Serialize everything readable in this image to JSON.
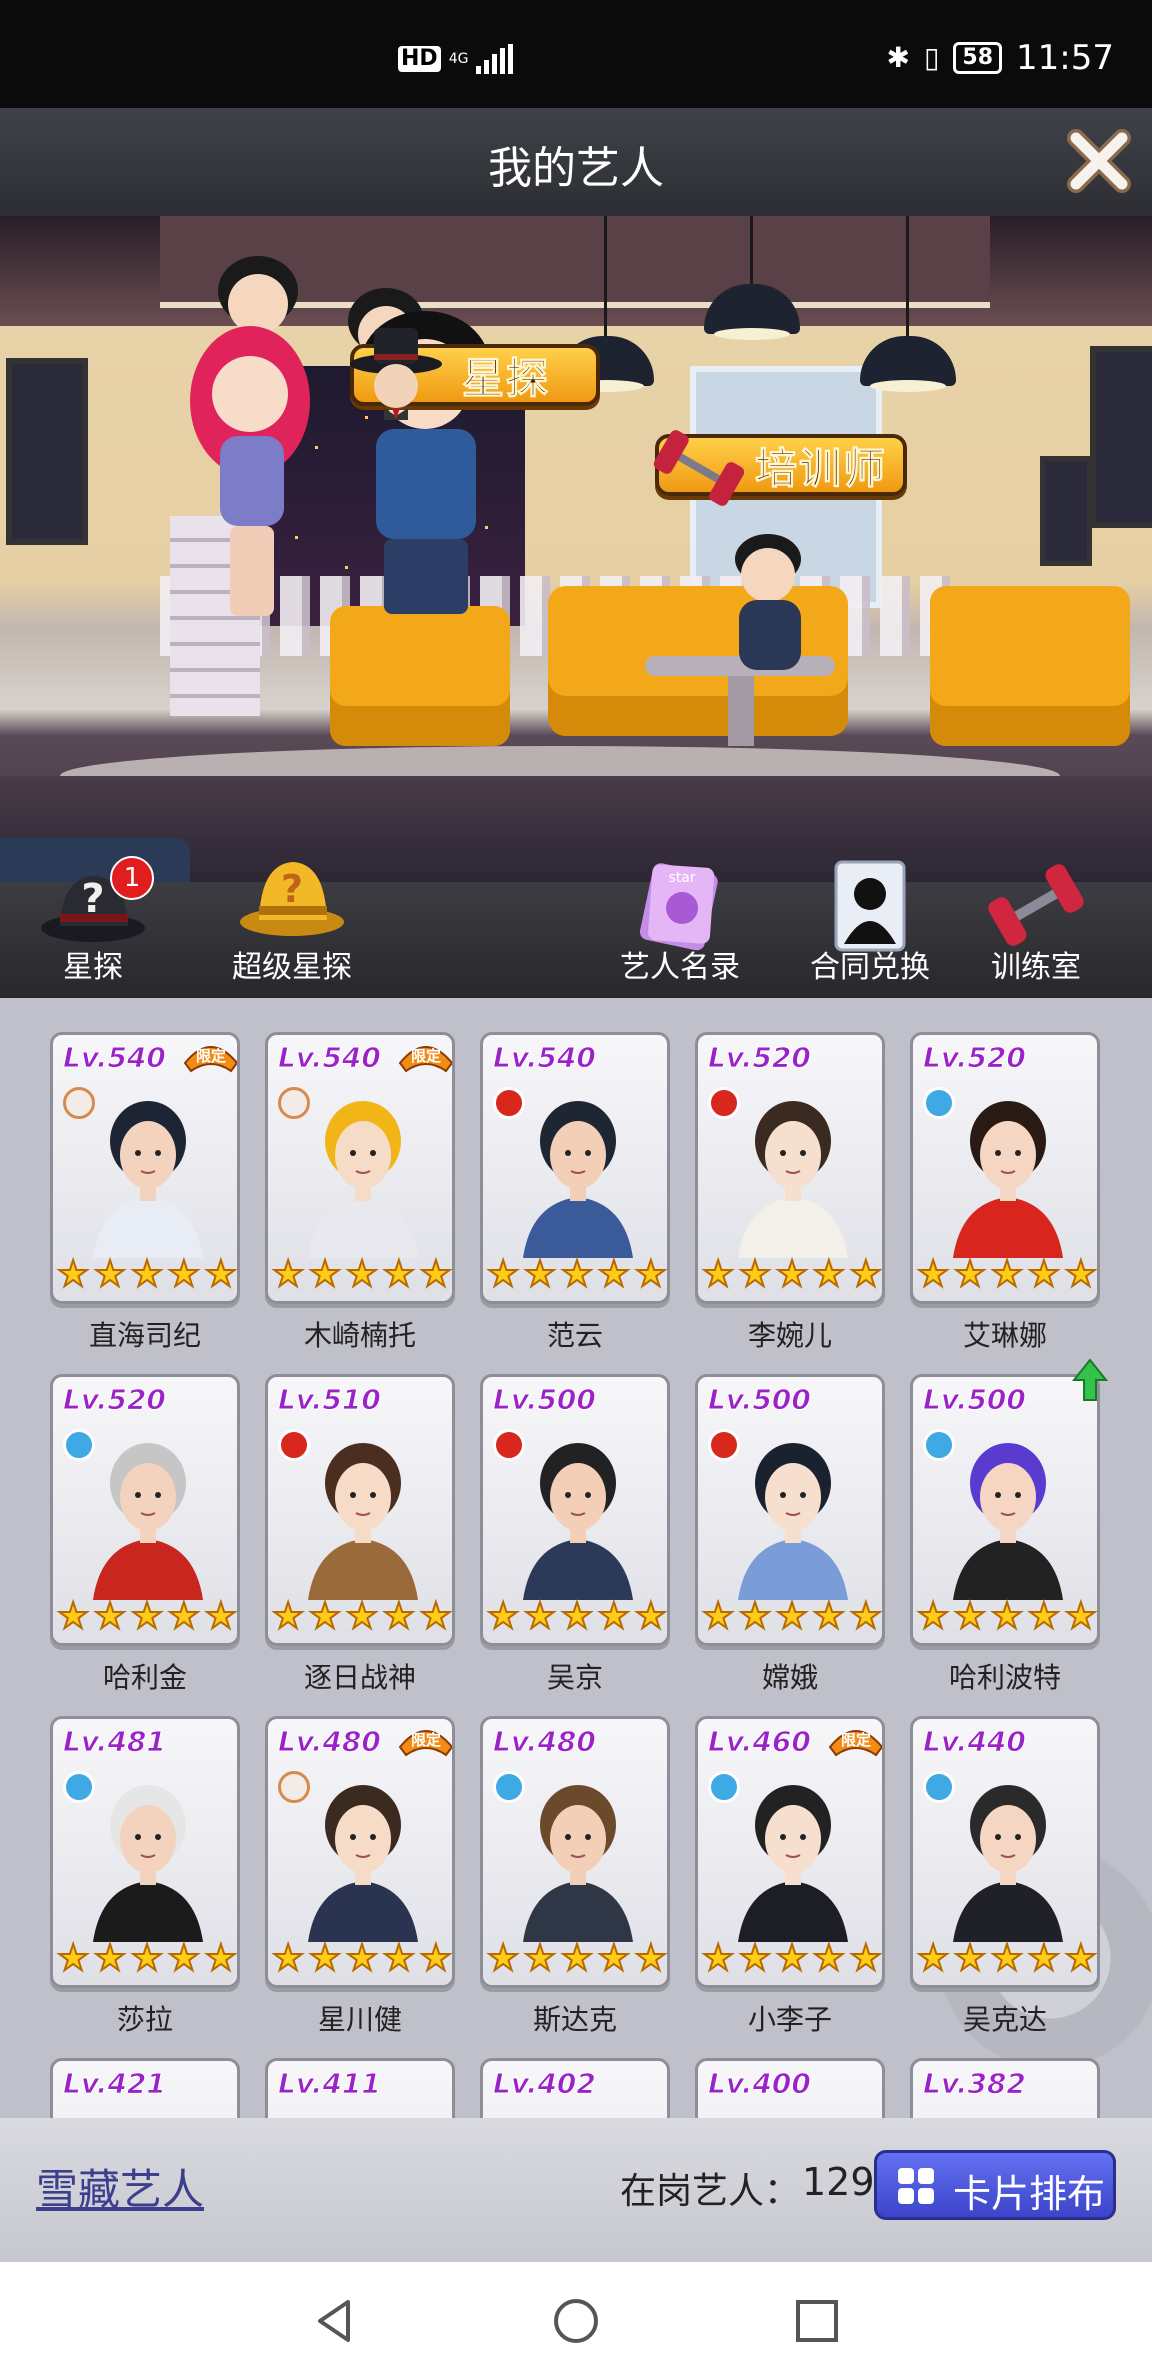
{
  "status_bar": {
    "hd": "HD",
    "network": "4G",
    "battery": "58",
    "time": "11:57"
  },
  "header": {
    "title": "我的艺人"
  },
  "scene": {
    "scout_label": "星探",
    "trainer_label": "培训师"
  },
  "menu": {
    "scout": {
      "label": "星探",
      "badge": "1"
    },
    "super_scout": {
      "label": "超级星探"
    },
    "directory": {
      "label": "艺人名录"
    },
    "contract": {
      "label": "合同兑换"
    },
    "training": {
      "label": "训练室"
    },
    "star_tag": "star"
  },
  "limited_tag": "限定",
  "elements": {
    "fire": "#d8281e",
    "crest": "#f1ece8",
    "water": "#3fa9e6"
  },
  "cards": [
    {
      "level": "Lv.540",
      "name": "直海司纪",
      "limited": true,
      "element": "crest",
      "stars": 5
    },
    {
      "level": "Lv.540",
      "name": "木崎楠托",
      "limited": true,
      "element": "crest",
      "stars": 5
    },
    {
      "level": "Lv.540",
      "name": "范云",
      "limited": false,
      "element": "fire",
      "stars": 5
    },
    {
      "level": "Lv.520",
      "name": "李婉儿",
      "limited": false,
      "element": "fire",
      "stars": 5
    },
    {
      "level": "Lv.520",
      "name": "艾琳娜",
      "limited": false,
      "element": "water",
      "stars": 5
    },
    {
      "level": "Lv.520",
      "name": "哈利金",
      "limited": false,
      "element": "water",
      "stars": 5
    },
    {
      "level": "Lv.510",
      "name": "逐日战神",
      "limited": false,
      "element": "fire",
      "stars": 5
    },
    {
      "level": "Lv.500",
      "name": "吴京",
      "limited": false,
      "element": "fire",
      "stars": 5
    },
    {
      "level": "Lv.500",
      "name": "嫦娥",
      "limited": false,
      "element": "fire",
      "stars": 5
    },
    {
      "level": "Lv.500",
      "name": "哈利波特",
      "limited": false,
      "element": "water",
      "stars": 5,
      "upgrade": true
    },
    {
      "level": "Lv.481",
      "name": "莎拉",
      "limited": false,
      "element": "water",
      "stars": 5
    },
    {
      "level": "Lv.480",
      "name": "星川健",
      "limited": true,
      "element": "crest",
      "stars": 5
    },
    {
      "level": "Lv.480",
      "name": "斯达克",
      "limited": false,
      "element": "water",
      "stars": 5
    },
    {
      "level": "Lv.460",
      "name": "小李子",
      "limited": true,
      "element": "water",
      "stars": 5
    },
    {
      "level": "Lv.440",
      "name": "吴克达",
      "limited": false,
      "element": "water",
      "stars": 5
    },
    {
      "level": "Lv.421",
      "name": "",
      "limited": false,
      "element": "",
      "stars": 0
    },
    {
      "level": "Lv.411",
      "name": "",
      "limited": false,
      "element": "",
      "stars": 0
    },
    {
      "level": "Lv.402",
      "name": "",
      "limited": false,
      "element": "",
      "stars": 0
    },
    {
      "level": "Lv.400",
      "name": "",
      "limited": false,
      "element": "",
      "stars": 0
    },
    {
      "level": "Lv.382",
      "name": "",
      "limited": false,
      "element": "",
      "stars": 0
    }
  ],
  "bottom": {
    "hidden_link": "雪藏艺人",
    "count_label": "在岗艺人：",
    "count_value": "129",
    "sort_label": "卡片排布"
  }
}
